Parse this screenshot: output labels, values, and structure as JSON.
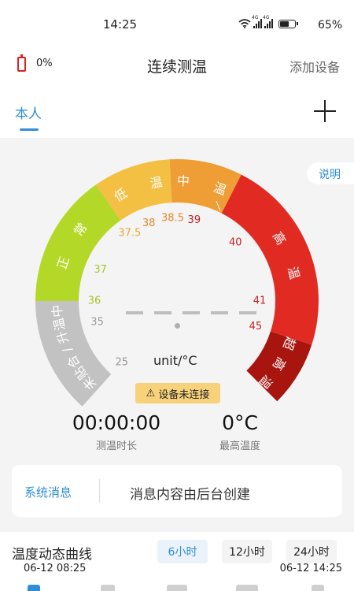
{
  "status_bar": {
    "time": "14:25",
    "battery_percent": "65%",
    "battery_level": 0.65,
    "signal_label": "4G"
  },
  "header": {
    "device_battery": "0%",
    "title": "连续测温",
    "add_device": "添加设备"
  },
  "tabs": {
    "current": "本人"
  },
  "explain_label": "说明",
  "gauge": {
    "segments": [
      {
        "name": "未贴合/升温中",
        "color": "#c2c2c2",
        "label_color": "#999999"
      },
      {
        "name": "正常",
        "color": "#b4d827",
        "label_color": "#a5c62a"
      },
      {
        "name": "低温",
        "color": "#f3c043",
        "label_color": "#e7a934"
      },
      {
        "name": "中温",
        "color": "#ef9d35",
        "label_color": "#e5862a"
      },
      {
        "name": "高温",
        "color": "#e12a22",
        "label_color": "#c91f1f"
      },
      {
        "name": "超高温",
        "color": "#a8140e",
        "label_color": "#c91f1f"
      }
    ],
    "ticks": [
      "25",
      "35",
      "36",
      "37",
      "37.5",
      "38",
      "38.5",
      "39",
      "40",
      "41",
      "45"
    ],
    "reading": "",
    "unit": "unit/°C",
    "warning": "设备未连接"
  },
  "stats": {
    "duration_value": "00:00:00",
    "duration_label": "测温时长",
    "max_value": "0°C",
    "max_label": "最高温度"
  },
  "message": {
    "tag": "系统消息",
    "text": "消息内容由后台创建"
  },
  "curve": {
    "title": "温度动态曲线",
    "ranges": [
      "6小时",
      "12小时",
      "24小时"
    ],
    "active_range": "6小时",
    "start": "06-12 08:25",
    "end": "06-12 14:25"
  }
}
